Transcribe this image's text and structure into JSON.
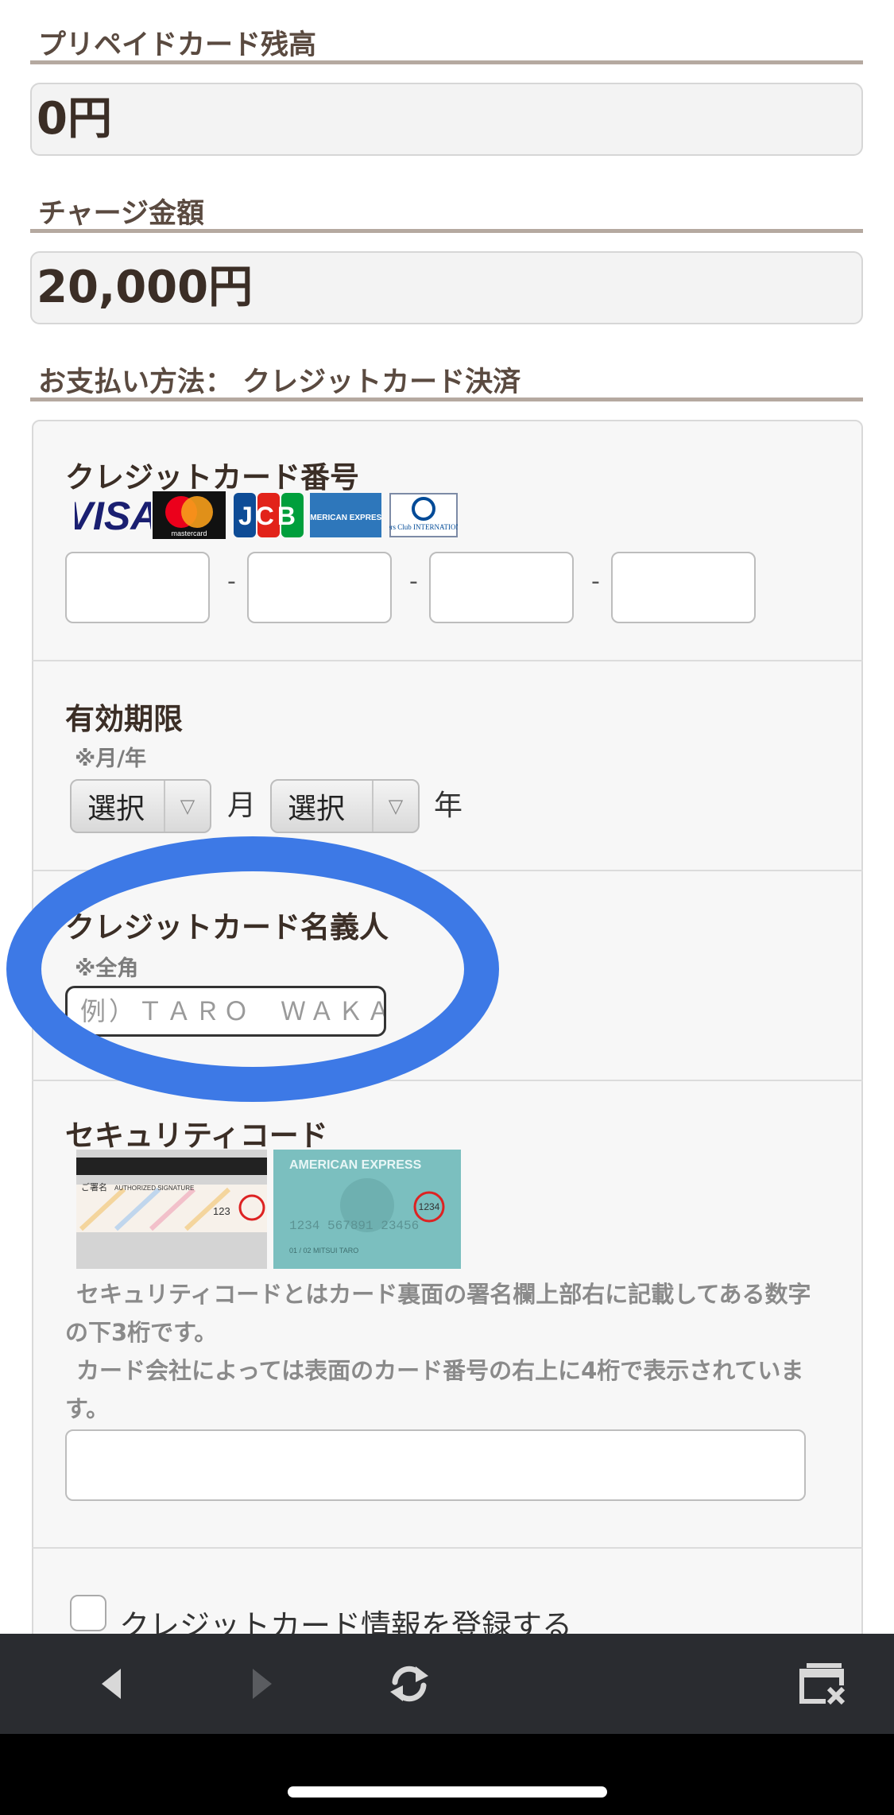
{
  "prepaid": {
    "label": "プリペイドカード残高",
    "value": "0円"
  },
  "charge": {
    "label": "チャージ金額",
    "value": "20,000円"
  },
  "payment_method": {
    "label": "お支払い方法： クレジットカード決済"
  },
  "card_number": {
    "label": "クレジットカード番号",
    "brands": [
      "VISA",
      "mastercard",
      "JCB",
      "AMERICAN EXPRESS",
      "Diners Club INTERNATIONAL"
    ],
    "separator": "-",
    "accent_blue": "#1a1f71",
    "accent_red": "#eb001b",
    "accent_orange": "#f79e1b"
  },
  "expiry": {
    "label": "有効期限",
    "note": "※月/年",
    "month_select": "選択",
    "month_unit": "月",
    "year_select": "選択",
    "year_unit": "年"
  },
  "holder": {
    "label": "クレジットカード名義人",
    "note": "※全角",
    "placeholder": "例）ＴＡＲＯ　ＷＡＫＡ",
    "highlight_color": "#3d79e6"
  },
  "security": {
    "label": "セキュリティコード",
    "card1_sig_label": "ご署名",
    "card1_sig_text": "AUTHORIZED SIGNATURE",
    "card1_code": "123",
    "card2_brand": "AMERICAN EXPRESS",
    "card2_code": "1234",
    "card2_number": "1234 567891 23456",
    "card2_meta": "01 / 02  MITSUI TARO",
    "help1": "セキュリティコードとはカード裏面の署名欄上部右に記載してある数字の下3桁です。",
    "help2": "カード会社によっては表面のカード番号の右上に4桁で表示されています。"
  },
  "register": {
    "label": "クレジットカード情報を登録する"
  },
  "toolbar": {
    "back": "back-icon",
    "forward": "forward-icon",
    "reload": "reload-icon",
    "close": "close-tabs-icon"
  }
}
